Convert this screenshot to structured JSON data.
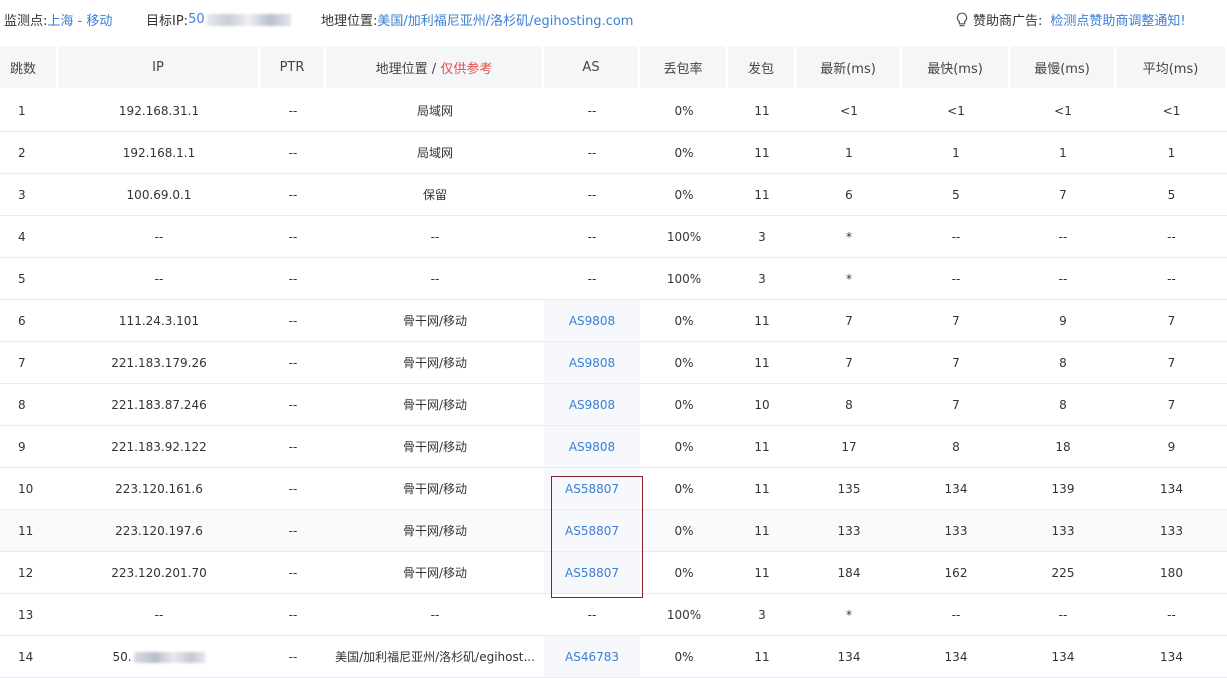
{
  "header": {
    "monitor_label": "监测点:",
    "monitor_value": "上海 - 移动",
    "target_label": "目标IP:",
    "target_value": "50",
    "geo_label": "地理位置:",
    "geo_value": "美国/加利福尼亚州/洛杉矶/egihosting.com",
    "sponsor_label": "赞助商广告:",
    "sponsor_value": "检测点赞助商调整通知!"
  },
  "columns": {
    "hop": "跳数",
    "ip": "IP",
    "ptr": "PTR",
    "geo_prefix": "地理位置 / ",
    "geo_warn": "仅供参考",
    "as": "AS",
    "loss": "丢包率",
    "sent": "发包",
    "last": "最新(ms)",
    "best": "最快(ms)",
    "worst": "最慢(ms)",
    "avg": "平均(ms)"
  },
  "rows": [
    {
      "hop": "1",
      "ip": "192.168.31.1",
      "ptr": "--",
      "geo": "局域网",
      "as": "--",
      "loss": "0%",
      "sent": "11",
      "last": "<1",
      "best": "<1",
      "worst": "<1",
      "avg": "<1"
    },
    {
      "hop": "2",
      "ip": "192.168.1.1",
      "ptr": "--",
      "geo": "局域网",
      "as": "--",
      "loss": "0%",
      "sent": "11",
      "last": "1",
      "best": "1",
      "worst": "1",
      "avg": "1"
    },
    {
      "hop": "3",
      "ip": "100.69.0.1",
      "ptr": "--",
      "geo": "保留",
      "as": "--",
      "loss": "0%",
      "sent": "11",
      "last": "6",
      "best": "5",
      "worst": "7",
      "avg": "5"
    },
    {
      "hop": "4",
      "ip": "--",
      "ptr": "--",
      "geo": "--",
      "as": "--",
      "loss": "100%",
      "sent": "3",
      "last": "*",
      "best": "--",
      "worst": "--",
      "avg": "--"
    },
    {
      "hop": "5",
      "ip": "--",
      "ptr": "--",
      "geo": "--",
      "as": "--",
      "loss": "100%",
      "sent": "3",
      "last": "*",
      "best": "--",
      "worst": "--",
      "avg": "--"
    },
    {
      "hop": "6",
      "ip": "111.24.3.101",
      "ptr": "--",
      "geo": "骨干网/移动",
      "as": "AS9808",
      "loss": "0%",
      "sent": "11",
      "last": "7",
      "best": "7",
      "worst": "9",
      "avg": "7"
    },
    {
      "hop": "7",
      "ip": "221.183.179.26",
      "ptr": "--",
      "geo": "骨干网/移动",
      "as": "AS9808",
      "loss": "0%",
      "sent": "11",
      "last": "7",
      "best": "7",
      "worst": "8",
      "avg": "7"
    },
    {
      "hop": "8",
      "ip": "221.183.87.246",
      "ptr": "--",
      "geo": "骨干网/移动",
      "as": "AS9808",
      "loss": "0%",
      "sent": "10",
      "last": "8",
      "best": "7",
      "worst": "8",
      "avg": "7"
    },
    {
      "hop": "9",
      "ip": "221.183.92.122",
      "ptr": "--",
      "geo": "骨干网/移动",
      "as": "AS9808",
      "loss": "0%",
      "sent": "11",
      "last": "17",
      "best": "8",
      "worst": "18",
      "avg": "9"
    },
    {
      "hop": "10",
      "ip": "223.120.161.6",
      "ptr": "--",
      "geo": "骨干网/移动",
      "as": "AS58807",
      "loss": "0%",
      "sent": "11",
      "last": "135",
      "best": "134",
      "worst": "139",
      "avg": "134"
    },
    {
      "hop": "11",
      "ip": "223.120.197.6",
      "ptr": "--",
      "geo": "骨干网/移动",
      "as": "AS58807",
      "loss": "0%",
      "sent": "11",
      "last": "133",
      "best": "133",
      "worst": "133",
      "avg": "133"
    },
    {
      "hop": "12",
      "ip": "223.120.201.70",
      "ptr": "--",
      "geo": "骨干网/移动",
      "as": "AS58807",
      "loss": "0%",
      "sent": "11",
      "last": "184",
      "best": "162",
      "worst": "225",
      "avg": "180"
    },
    {
      "hop": "13",
      "ip": "--",
      "ptr": "--",
      "geo": "--",
      "as": "--",
      "loss": "100%",
      "sent": "3",
      "last": "*",
      "best": "--",
      "worst": "--",
      "avg": "--"
    },
    {
      "hop": "14",
      "ip": "50.",
      "ptr": "--",
      "geo": "美国/加利福尼亚州/洛杉矶/egihost...",
      "as": "AS46783",
      "loss": "0%",
      "sent": "11",
      "last": "134",
      "best": "134",
      "worst": "134",
      "avg": "134"
    }
  ],
  "highlighted_row": "11",
  "colors": {
    "link": "#3b7fd4",
    "warn": "#e05050",
    "header_bg": "#f5f6f8",
    "annotation_box": "#8b1c2c"
  }
}
